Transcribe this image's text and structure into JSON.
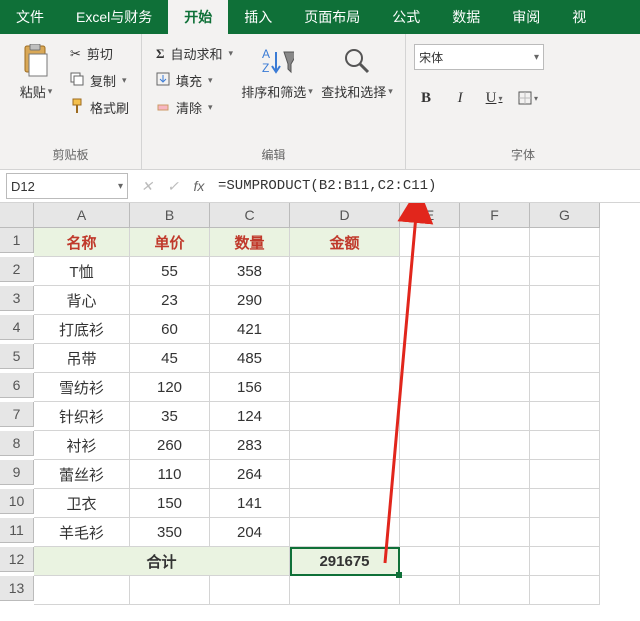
{
  "tabs": {
    "file": "文件",
    "custom": "Excel与财务",
    "home": "开始",
    "insert": "插入",
    "layout": "页面布局",
    "formulas": "公式",
    "data": "数据",
    "review": "审阅",
    "view": "视"
  },
  "ribbon": {
    "clipboard": {
      "paste": "粘贴",
      "cut": "剪切",
      "copy": "复制",
      "format_painter": "格式刷",
      "group_label": "剪贴板"
    },
    "editing": {
      "autosum": "自动求和",
      "fill": "填充",
      "clear": "清除",
      "sort_filter": "排序和筛选",
      "find_select": "查找和选择",
      "group_label": "编辑"
    },
    "font": {
      "name": "宋体",
      "bold": "B",
      "italic": "I",
      "underline": "U",
      "group_label": "字体"
    }
  },
  "namebox": "D12",
  "formula": "=SUMPRODUCT(B2:B11,C2:C11)",
  "cancel_glyph": "✕",
  "accept_glyph": "✓",
  "fx_glyph": "fx",
  "columns": [
    "A",
    "B",
    "C",
    "D",
    "E",
    "F",
    "G"
  ],
  "headers": {
    "name": "名称",
    "price": "单价",
    "qty": "数量",
    "amount": "金额"
  },
  "rows": [
    {
      "name": "T恤",
      "price": 55,
      "qty": 358
    },
    {
      "name": "背心",
      "price": 23,
      "qty": 290
    },
    {
      "name": "打底衫",
      "price": 60,
      "qty": 421
    },
    {
      "name": "吊带",
      "price": 45,
      "qty": 485
    },
    {
      "name": "雪纺衫",
      "price": 120,
      "qty": 156
    },
    {
      "name": "针织衫",
      "price": 35,
      "qty": 124
    },
    {
      "name": "衬衫",
      "price": 260,
      "qty": 283
    },
    {
      "name": "蕾丝衫",
      "price": 110,
      "qty": 264
    },
    {
      "name": "卫衣",
      "price": 150,
      "qty": 141
    },
    {
      "name": "羊毛衫",
      "price": 350,
      "qty": 204
    }
  ],
  "total_label": "合计",
  "total_value": 291675,
  "chart_data": {
    "type": "table",
    "title": "",
    "columns": [
      "名称",
      "单价",
      "数量",
      "金额"
    ],
    "rows": [
      [
        "T恤",
        55,
        358,
        null
      ],
      [
        "背心",
        23,
        290,
        null
      ],
      [
        "打底衫",
        60,
        421,
        null
      ],
      [
        "吊带",
        45,
        485,
        null
      ],
      [
        "雪纺衫",
        120,
        156,
        null
      ],
      [
        "针织衫",
        35,
        124,
        null
      ],
      [
        "衬衫",
        260,
        283,
        null
      ],
      [
        "蕾丝衫",
        110,
        264,
        null
      ],
      [
        "卫衣",
        150,
        141,
        null
      ],
      [
        "羊毛衫",
        350,
        204,
        null
      ]
    ],
    "total": {
      "label": "合计",
      "amount": 291675
    },
    "formula": "=SUMPRODUCT(B2:B11,C2:C11)"
  }
}
